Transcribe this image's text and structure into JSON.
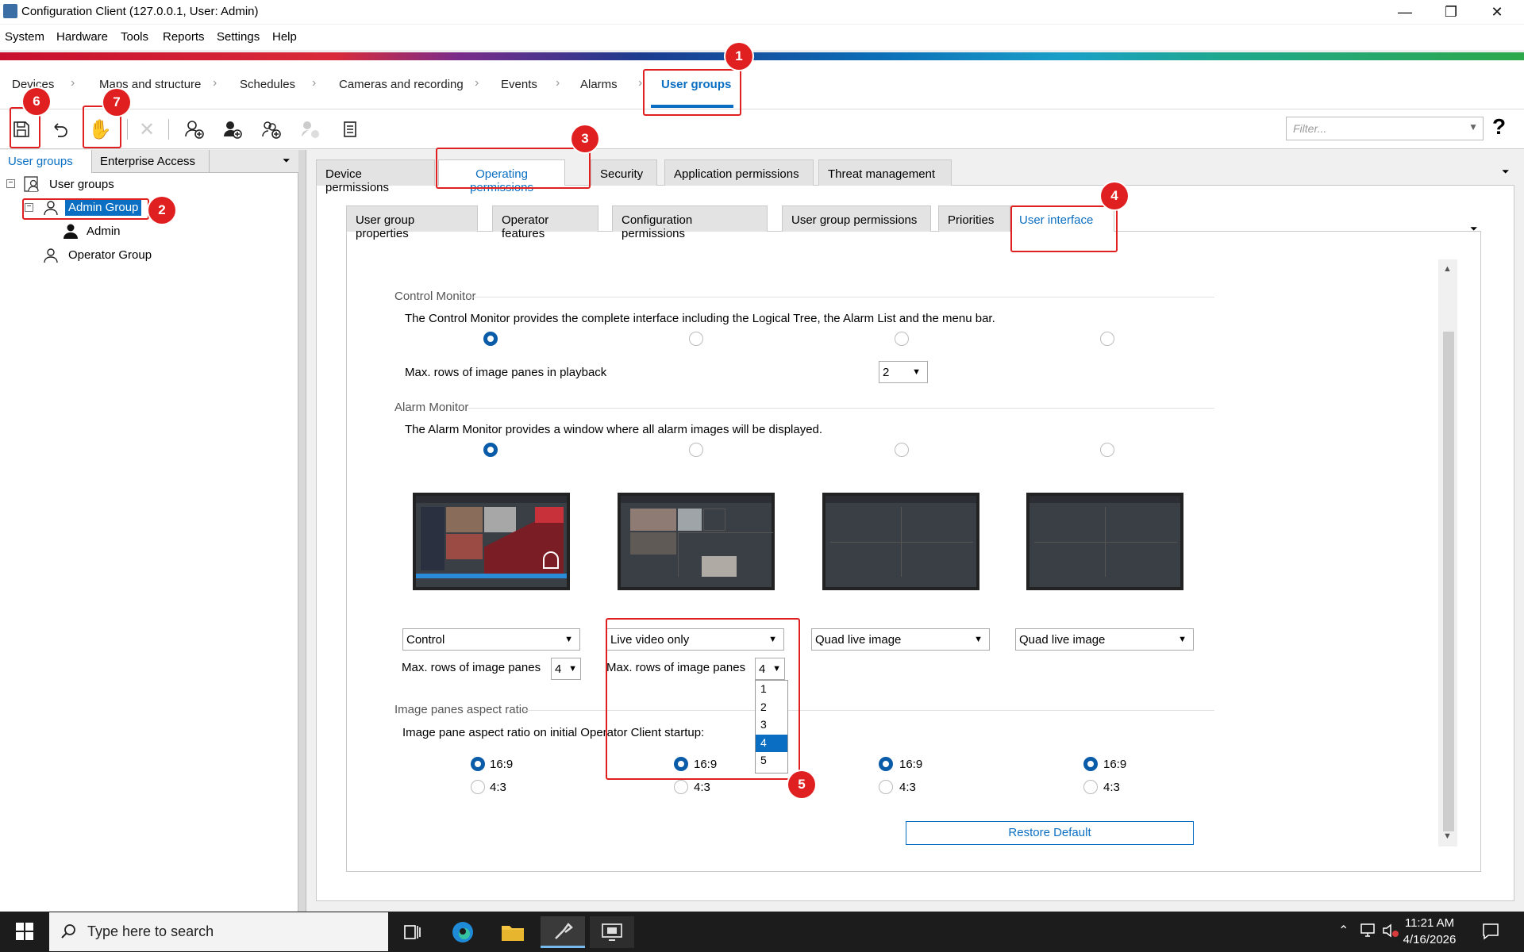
{
  "window": {
    "title": "Configuration Client (127.0.0.1, User: Admin)",
    "controls": [
      "—",
      "❐",
      "✕"
    ]
  },
  "menu": [
    "System",
    "Hardware",
    "Tools",
    "Reports",
    "Settings",
    "Help"
  ],
  "nav": {
    "items": [
      "Devices",
      "Maps and structure",
      "Schedules",
      "Cameras and recording",
      "Events",
      "Alarms",
      "User groups"
    ],
    "active": "User groups"
  },
  "toolbar": {
    "filter_placeholder": "Filter...",
    "help": "?"
  },
  "left_panel": {
    "tabs": [
      "User groups",
      "Enterprise Access"
    ],
    "tree": {
      "root": "User groups",
      "admin_group": "Admin Group",
      "admin_user": "Admin",
      "operator_group": "Operator Group"
    }
  },
  "tabs_level1": [
    "Device permissions",
    "Operating permissions",
    "Security",
    "Application permissions",
    "Threat management"
  ],
  "tabs_level2": [
    "User group properties",
    "Operator features",
    "Configuration permissions",
    "User group permissions",
    "Priorities",
    "User interface"
  ],
  "control_monitor": {
    "heading": "Control Monitor",
    "description": "The Control Monitor provides the complete interface including the Logical Tree, the Alarm List and the menu bar.",
    "rows_label": "Max. rows of image panes in playback",
    "rows_value": "2"
  },
  "alarm_monitor": {
    "heading": "Alarm Monitor",
    "description": "The Alarm Monitor provides a window where all alarm images will be displayed.",
    "monitors": [
      {
        "mode": "Control",
        "rows_label": "Max. rows of image panes",
        "rows_value": "4"
      },
      {
        "mode": "Live video only",
        "rows_label": "Max. rows of image panes",
        "rows_value": "4"
      },
      {
        "mode": "Quad live image"
      },
      {
        "mode": "Quad live image"
      }
    ],
    "dropdown_options": [
      "1",
      "2",
      "3",
      "4",
      "5"
    ],
    "dropdown_selected": "4"
  },
  "aspect_ratio": {
    "heading": "Image panes aspect ratio",
    "description": "Image pane aspect ratio on initial Operator Client startup:",
    "option_a": "16:9",
    "option_b": "4:3"
  },
  "restore_default": "Restore Default",
  "annotations": [
    "1",
    "2",
    "3",
    "4",
    "5",
    "6",
    "7"
  ],
  "taskbar": {
    "search_placeholder": "Type here to search",
    "time": "11:21 AM",
    "date": "4/16/2026"
  },
  "colors": {
    "accent": "#0a6fc2",
    "annotation": "#e02020",
    "radio_on": "#0a5ba8"
  }
}
